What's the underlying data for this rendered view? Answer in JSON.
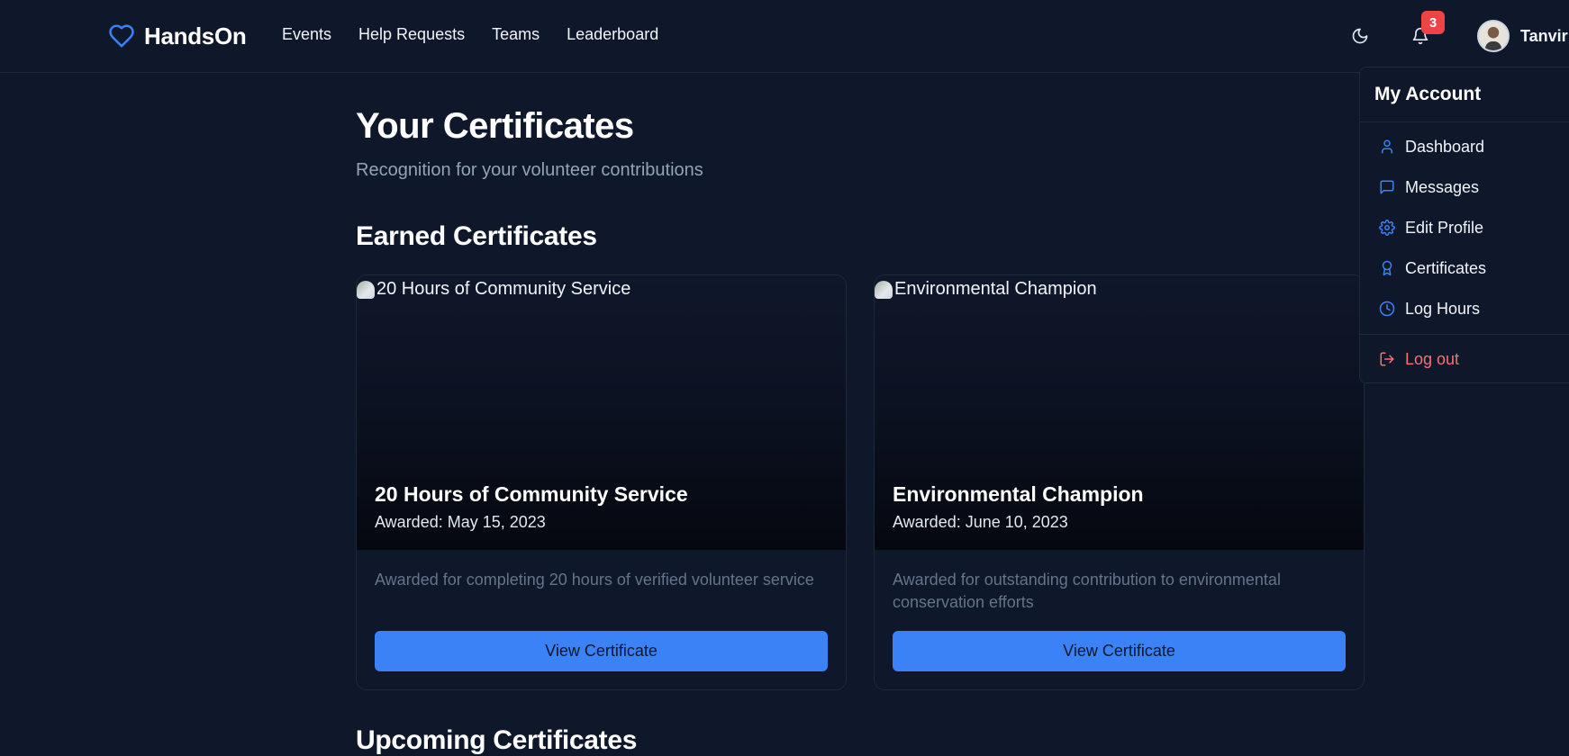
{
  "header": {
    "brand": "HandsOn",
    "nav": [
      "Events",
      "Help Requests",
      "Teams",
      "Leaderboard"
    ],
    "notification_count": "3",
    "user_name": "Tanvir"
  },
  "main": {
    "title": "Your Certificates",
    "subtitle": "Recognition for your volunteer contributions",
    "earned_section": "Earned Certificates",
    "upcoming_section": "Upcoming Certificates",
    "certificates": [
      {
        "image_alt": "20 Hours of Community Service",
        "title": "20 Hours of Community Service",
        "awarded": "Awarded: May 15, 2023",
        "description": "Awarded for completing 20 hours of verified volunteer service",
        "button": "View Certificate"
      },
      {
        "image_alt": "Environmental Champion",
        "title": "Environmental Champion",
        "awarded": "Awarded: June 10, 2023",
        "description": "Awarded for outstanding contribution to environmental conservation efforts",
        "button": "View Certificate"
      }
    ]
  },
  "dropdown": {
    "title": "My Account",
    "items": [
      {
        "label": "Dashboard",
        "icon": "user-icon"
      },
      {
        "label": "Messages",
        "icon": "message-icon"
      },
      {
        "label": "Edit Profile",
        "icon": "gear-icon"
      },
      {
        "label": "Certificates",
        "icon": "award-icon"
      },
      {
        "label": "Log Hours",
        "icon": "clock-icon"
      }
    ],
    "logout": {
      "label": "Log out",
      "icon": "logout-icon"
    }
  },
  "colors": {
    "background": "#0f172a",
    "accent": "#3b82f6",
    "danger": "#ef4444",
    "muted": "#94a3b8"
  }
}
